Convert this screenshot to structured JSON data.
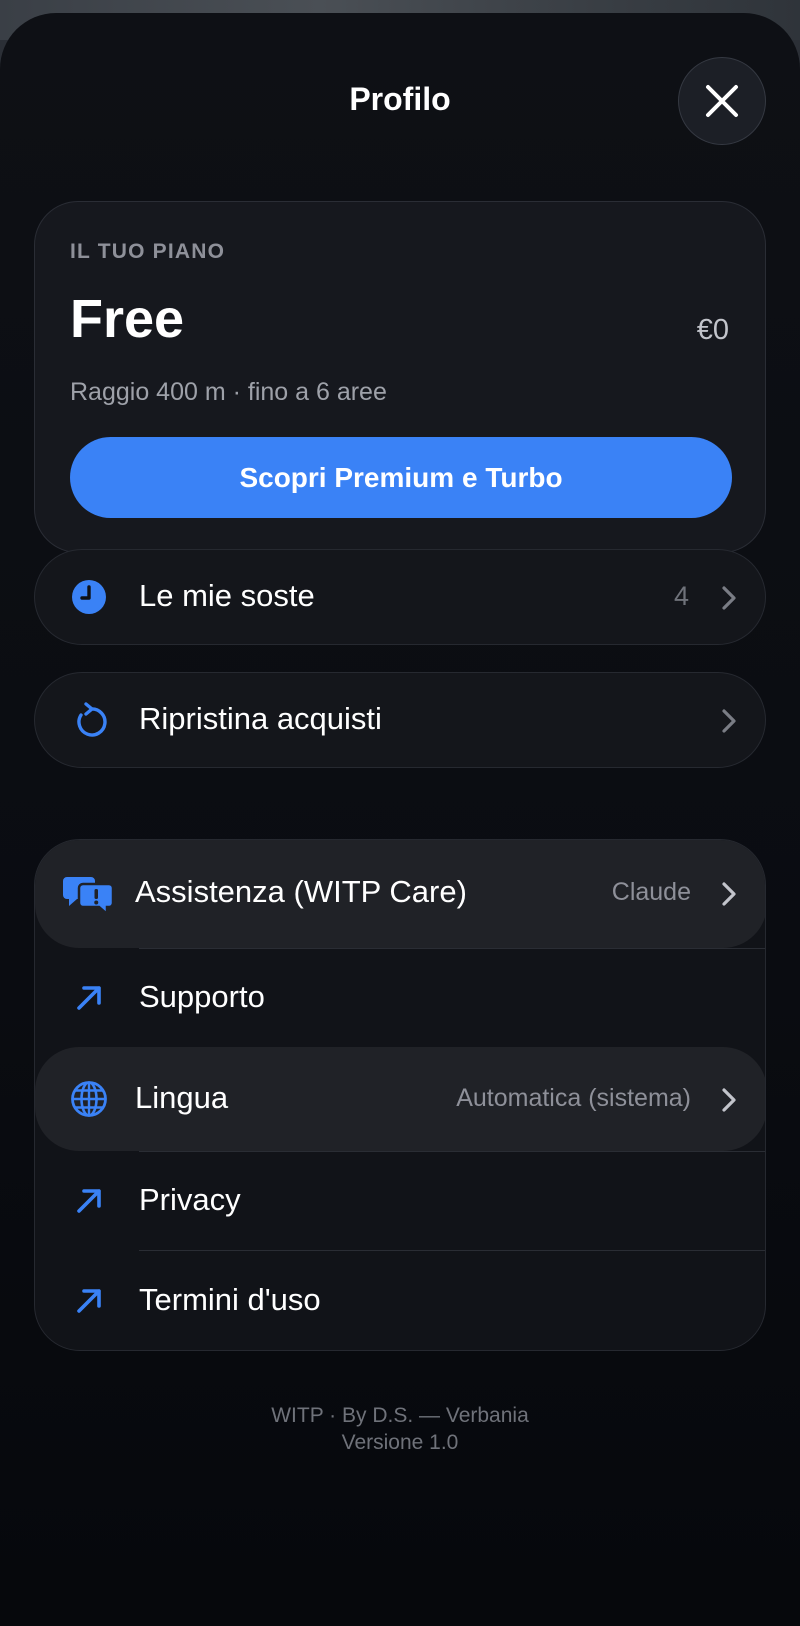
{
  "header": {
    "title": "Profilo",
    "close_icon": "close-icon"
  },
  "plan": {
    "eyebrow": "IL TUO PIANO",
    "name": "Free",
    "price": "€0",
    "description": "Raggio 400 m · fino a 6 aree",
    "cta_label": "Scopri Premium e Turbo"
  },
  "menu": {
    "stops": {
      "label": "Le mie soste",
      "count": "4",
      "icon": "clock-icon"
    },
    "restore": {
      "label": "Ripristina acquisti",
      "icon": "refresh-icon"
    },
    "group": {
      "assistance": {
        "label": "Assistenza (WITP Care)",
        "value": "Claude",
        "icon": "chat-alert-icon"
      },
      "support": {
        "label": "Supporto",
        "icon": "external-link-icon"
      },
      "language": {
        "label": "Lingua",
        "value": "Automatica (sistema)",
        "icon": "globe-icon"
      },
      "privacy": {
        "label": "Privacy",
        "icon": "external-link-icon"
      },
      "terms": {
        "label": "Termini d'uso",
        "icon": "external-link-icon"
      }
    }
  },
  "footer": {
    "credit": "WITP · By D.S. — Verbania",
    "version": "Versione 1.0"
  },
  "colors": {
    "accent": "#3a82f6",
    "background": "#0a0c11",
    "card": "#16181e"
  }
}
